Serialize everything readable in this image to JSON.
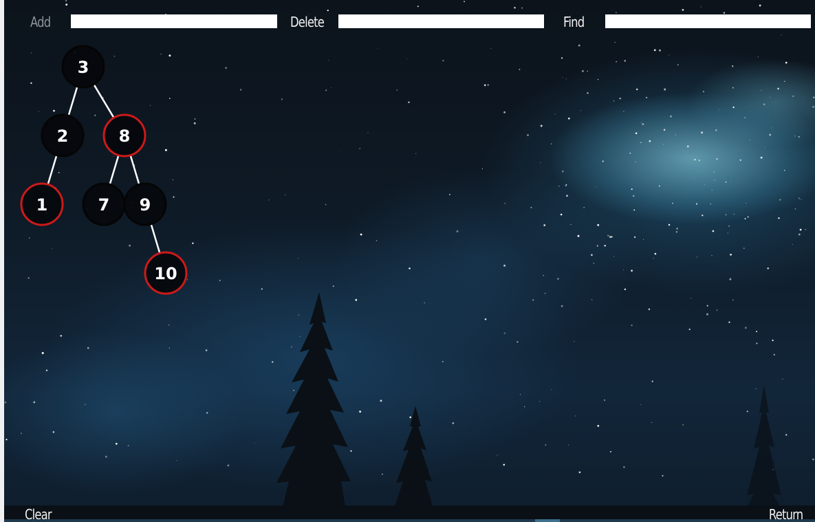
{
  "toolbar": {
    "add_label": "Add",
    "add_value": "",
    "delete_label": "Delete",
    "delete_value": "",
    "find_label": "Find",
    "find_value": ""
  },
  "tree": {
    "type": "red-black-tree",
    "colors": {
      "black": "#050505",
      "red": "#cc1a1a",
      "edge": "#ffffff",
      "label": "#ffffff"
    },
    "nodes": [
      {
        "value": "3",
        "color": "black",
        "parent": null
      },
      {
        "value": "2",
        "color": "black",
        "parent": "3"
      },
      {
        "value": "8",
        "color": "red",
        "parent": "3"
      },
      {
        "value": "1",
        "color": "red",
        "parent": "2"
      },
      {
        "value": "7",
        "color": "black",
        "parent": "8"
      },
      {
        "value": "9",
        "color": "black",
        "parent": "8"
      },
      {
        "value": "10",
        "color": "red",
        "parent": "9"
      }
    ]
  },
  "footer": {
    "clear_label": "Clear",
    "return_label": "Return"
  }
}
